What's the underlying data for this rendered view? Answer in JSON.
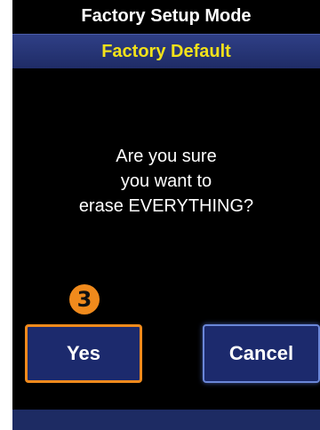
{
  "header": {
    "title": "Factory Setup Mode",
    "subtitle": "Factory Default"
  },
  "dialog": {
    "message": "Are you sure\nyou want to\nerase EVERYTHING?",
    "yes_label": "Yes",
    "cancel_label": "Cancel"
  },
  "annotation": {
    "step_number": "3"
  },
  "colors": {
    "subtitle_text": "#f2e21a",
    "button_fill": "#1c2a6d",
    "highlight": "#f08a1c",
    "cancel_border": "#6a86d8"
  }
}
